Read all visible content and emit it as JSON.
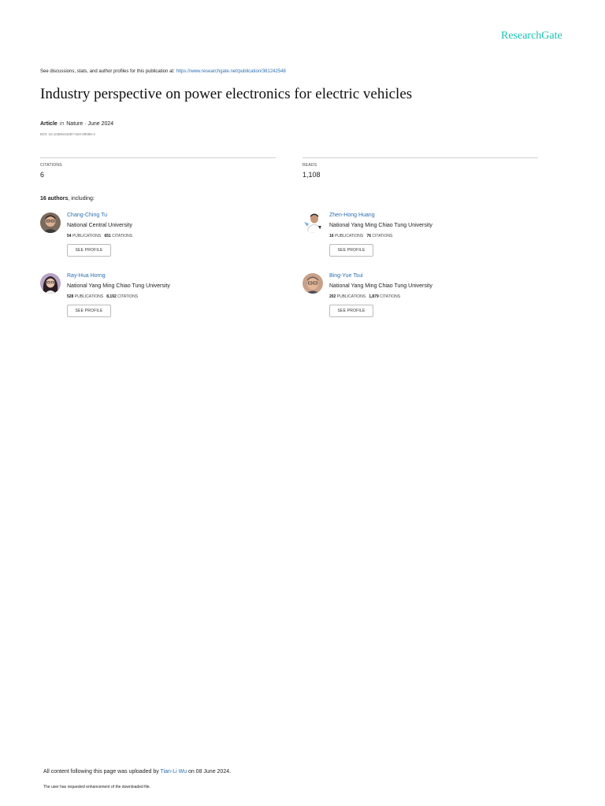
{
  "header": {
    "logo": "ResearchGate"
  },
  "intro": {
    "text": "See discussions, stats, and author profiles for this publication at: ",
    "link": "https://www.researchgate.net/publication/381242548"
  },
  "publication": {
    "title": "Industry perspective on power electronics for electric vehicles",
    "type": "Article",
    "in_word": "in",
    "venue_date": "Nature · June 2024",
    "doi": "DOI: 10.1038/s44287-024-00055-4"
  },
  "stats": {
    "citations_label": "CITATIONS",
    "citations_value": "6",
    "reads_label": "READS",
    "reads_value": "1,108"
  },
  "authors_header": {
    "count": "16 authors",
    "suffix": ", including:"
  },
  "authors": [
    {
      "name": "Chang-Ching Tu",
      "institution": "National Central University",
      "publications": "54",
      "publications_label": "PUBLICATIONS",
      "citations": "651",
      "citations_label": "CITATIONS",
      "button": "SEE PROFILE"
    },
    {
      "name": "Zhen-Hong Huang",
      "institution": "National Yang Ming Chiao Tung University",
      "publications": "16",
      "publications_label": "PUBLICATIONS",
      "citations": "76",
      "citations_label": "CITATIONS",
      "button": "SEE PROFILE"
    },
    {
      "name": "Ray-Hua Horng",
      "institution": "National Yang Ming Chiao Tung University",
      "publications": "528",
      "publications_label": "PUBLICATIONS",
      "citations": "8,192",
      "citations_label": "CITATIONS",
      "button": "SEE PROFILE"
    },
    {
      "name": "Bing-Yue Tsui",
      "institution": "National Yang Ming Chiao Tung University",
      "publications": "202",
      "publications_label": "PUBLICATIONS",
      "citations": "1,879",
      "citations_label": "CITATIONS",
      "button": "SEE PROFILE"
    }
  ],
  "footer": {
    "uploaded_prefix": "All content following this page was uploaded by ",
    "uploader": "Tian-Li Wu",
    "uploaded_suffix": " on 08 June 2024.",
    "enhancement": "The user has requested enhancement of the downloaded file."
  },
  "colors": {
    "brand": "#19c3b0",
    "link": "#2a6fb0"
  }
}
